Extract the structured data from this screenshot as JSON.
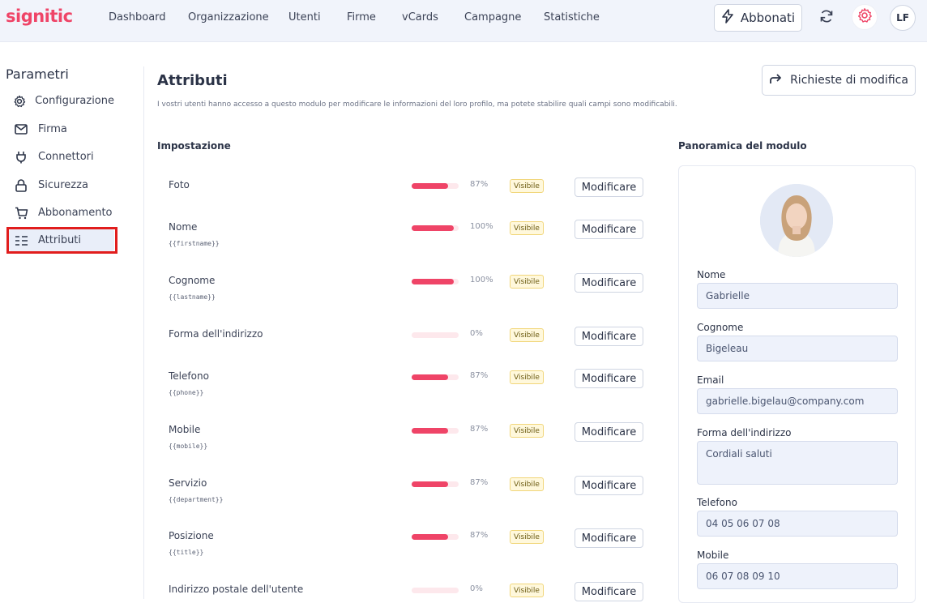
{
  "brand": {
    "logo": "signitic",
    "accent": "#ef4467"
  },
  "nav": {
    "items": [
      "Dashboard",
      "Organizzazione",
      "Utenti",
      "Firme",
      "vCards",
      "Campagne",
      "Statistiche"
    ],
    "subscribe_label": "Abbonati",
    "user_initials": "LF"
  },
  "sidebar": {
    "title": "Parametri",
    "items": [
      {
        "label": "Configurazione",
        "icon": "gear-icon"
      },
      {
        "label": "Firma",
        "icon": "mail-icon"
      },
      {
        "label": "Connettori",
        "icon": "plug-icon"
      },
      {
        "label": "Sicurezza",
        "icon": "lock-icon"
      },
      {
        "label": "Abbonamento",
        "icon": "cart-icon"
      },
      {
        "label": "Attributi",
        "icon": "list-icon"
      }
    ]
  },
  "main": {
    "title": "Attributi",
    "description": "I vostri utenti hanno accesso a questo modulo per modificare le informazioni del loro profilo, ma potete stabilire quali campi sono modificabili.",
    "requests_label": "Richieste di modifica",
    "settings_heading": "Impostazione",
    "overview_heading": "Panoramica del modulo",
    "modify_label": "Modificare",
    "attributes": [
      {
        "name": "Foto",
        "var": "",
        "pct": 87,
        "pct_label": "87%",
        "badge": "Visibile"
      },
      {
        "name": "Nome",
        "var": "{{firstname}}",
        "pct": 100,
        "pct_label": "100%",
        "badge": "Visibile"
      },
      {
        "name": "Cognome",
        "var": "{{lastname}}",
        "pct": 100,
        "pct_label": "100%",
        "badge": "Visibile"
      },
      {
        "name": "Forma dell'indirizzo",
        "var": "",
        "pct": 0,
        "pct_label": "0%",
        "badge": "Visibile"
      },
      {
        "name": "Telefono",
        "var": "{{phone}}",
        "pct": 87,
        "pct_label": "87%",
        "badge": "Visibile"
      },
      {
        "name": "Mobile",
        "var": "{{mobile}}",
        "pct": 87,
        "pct_label": "87%",
        "badge": "Visibile"
      },
      {
        "name": "Servizio",
        "var": "{{department}}",
        "pct": 87,
        "pct_label": "87%",
        "badge": "Visibile"
      },
      {
        "name": "Posizione",
        "var": "{{title}}",
        "pct": 87,
        "pct_label": "87%",
        "badge": "Visibile"
      },
      {
        "name": "Indirizzo postale dell'utente",
        "var": "",
        "pct": 0,
        "pct_label": "0%",
        "badge": "Visibile"
      }
    ]
  },
  "preview": {
    "fields": [
      {
        "label": "Nome",
        "value": "Gabrielle"
      },
      {
        "label": "Cognome",
        "value": "Bigeleau"
      },
      {
        "label": "Email",
        "value": "gabrielle.bigelau@company.com"
      },
      {
        "label": "Forma dell'indirizzo",
        "value": "Cordiali saluti",
        "multiline": true
      },
      {
        "label": "Telefono",
        "value": "04 05 06 07 08"
      },
      {
        "label": "Mobile",
        "value": "06 07 08 09 10"
      }
    ]
  }
}
